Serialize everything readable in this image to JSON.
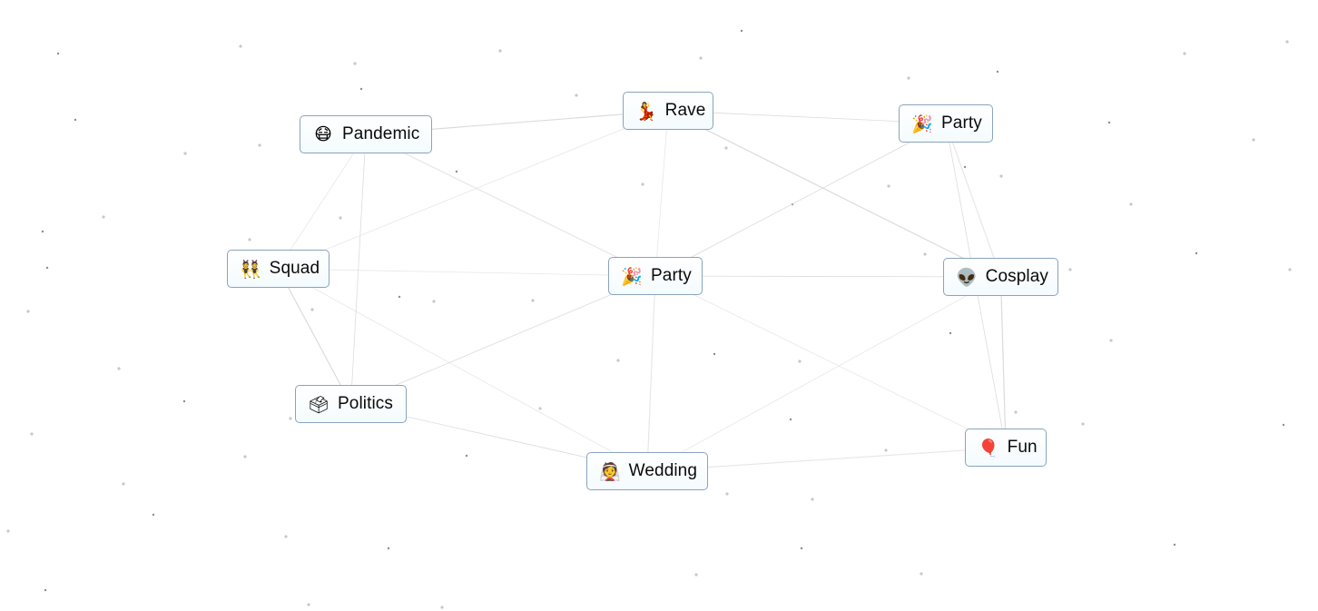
{
  "canvas": {
    "background": "#ffffff",
    "edge_color": "#d8d8d8",
    "node_border_color": "#8aa3bd"
  },
  "nodes": [
    {
      "id": "pandemic",
      "label": "Pandemic",
      "emoji": "😷",
      "icon": "face-with-medical-mask-icon"
    },
    {
      "id": "rave",
      "label": "Rave",
      "emoji": "💃",
      "icon": "woman-dancing-icon"
    },
    {
      "id": "party_top",
      "label": "Party",
      "emoji": "🎉",
      "icon": "party-popper-icon"
    },
    {
      "id": "squad",
      "label": "Squad",
      "emoji": "👯",
      "icon": "people-with-bunny-ears-icon"
    },
    {
      "id": "party_center",
      "label": "Party",
      "emoji": "🎉",
      "icon": "party-popper-icon"
    },
    {
      "id": "cosplay",
      "label": "Cosplay",
      "emoji": "👽",
      "icon": "alien-icon"
    },
    {
      "id": "politics",
      "label": "Politics",
      "emoji": "🗳",
      "icon": "ballot-box-icon"
    },
    {
      "id": "wedding",
      "label": "Wedding",
      "emoji": "👰",
      "icon": "bride-with-veil-icon"
    },
    {
      "id": "fun",
      "label": "Fun",
      "emoji": "🎈",
      "icon": "balloon-icon"
    }
  ],
  "edges": [
    [
      "pandemic",
      "rave"
    ],
    [
      "pandemic",
      "squad"
    ],
    [
      "pandemic",
      "politics"
    ],
    [
      "pandemic",
      "party_center"
    ],
    [
      "rave",
      "party_top"
    ],
    [
      "rave",
      "party_center"
    ],
    [
      "rave",
      "cosplay"
    ],
    [
      "rave",
      "squad"
    ],
    [
      "party_top",
      "party_center"
    ],
    [
      "party_top",
      "cosplay"
    ],
    [
      "party_top",
      "fun"
    ],
    [
      "squad",
      "party_center"
    ],
    [
      "squad",
      "politics"
    ],
    [
      "squad",
      "wedding"
    ],
    [
      "party_center",
      "cosplay"
    ],
    [
      "party_center",
      "wedding"
    ],
    [
      "party_center",
      "politics"
    ],
    [
      "party_center",
      "fun"
    ],
    [
      "cosplay",
      "fun"
    ],
    [
      "cosplay",
      "wedding"
    ],
    [
      "politics",
      "wedding"
    ],
    [
      "wedding",
      "fun"
    ]
  ]
}
